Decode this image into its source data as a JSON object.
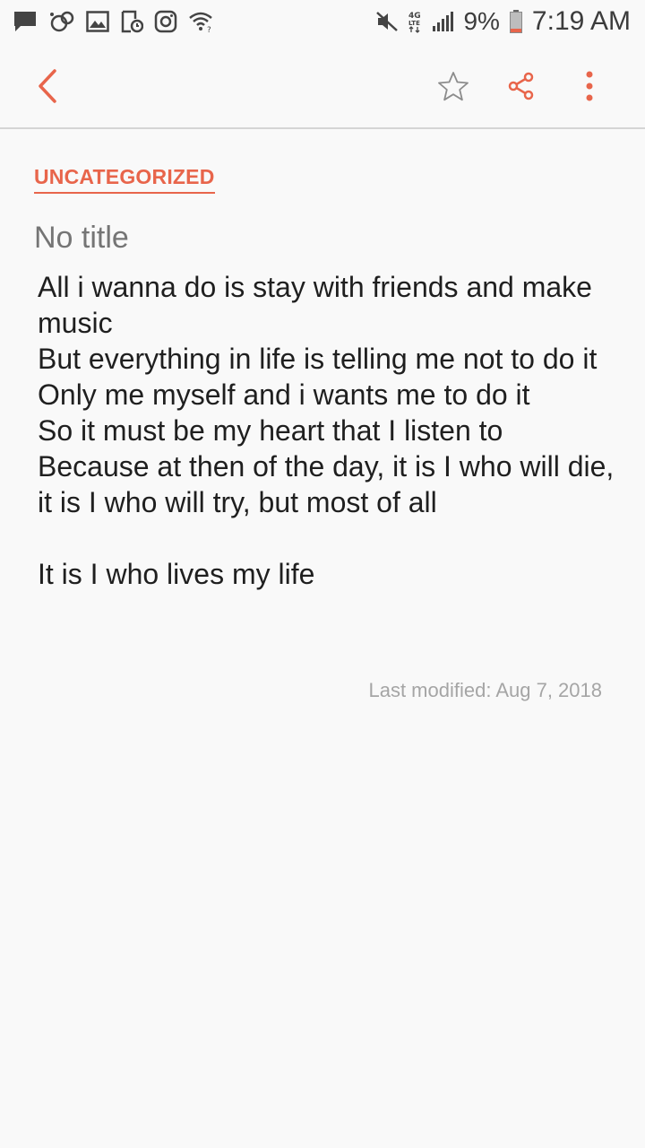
{
  "status_bar": {
    "left_icons": [
      "message-icon",
      "sync-icon",
      "gallery-icon",
      "screen-record-icon",
      "instagram-icon",
      "wifi-icon"
    ],
    "right_icons": [
      "mute-icon",
      "lte-icon",
      "signal-icon",
      "battery-icon"
    ],
    "network_label": "4G LTE",
    "battery_percent": "9%",
    "time": "7:19 AM"
  },
  "toolbar": {
    "back_icon": "chevron-left-icon",
    "favorite_icon": "star-icon",
    "share_icon": "share-icon",
    "more_icon": "more-vert-icon",
    "accent_color": "#e8654b"
  },
  "note": {
    "category": "UNCATEGORIZED",
    "title_placeholder": "No title",
    "body": "All i wanna do is stay with friends and make music\nBut everything in life is telling me not to do it\nOnly me myself and i wants me to do it\nSo it must be my heart that I listen to\nBecause at then of the day, it is I who will die, it is I who will try, but most of all\n\nIt is I who lives my life",
    "last_modified": "Last modified: Aug 7, 2018"
  }
}
